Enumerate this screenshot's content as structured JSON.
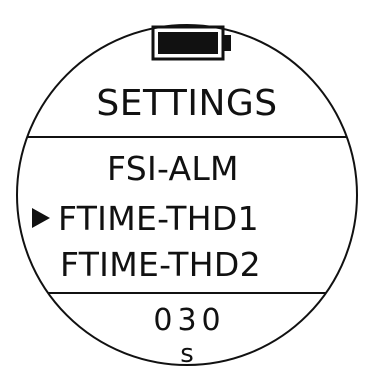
{
  "status": {
    "battery_icon": "battery-full-icon"
  },
  "header": {
    "title": "SETTINGS"
  },
  "menu": {
    "items": [
      "FSI-ALM",
      "FTIME-THD1",
      "FTIME-THD2"
    ],
    "selected_index": 1,
    "cursor_icon": "triangle-right-icon"
  },
  "value": {
    "number": "030",
    "unit": "s"
  }
}
